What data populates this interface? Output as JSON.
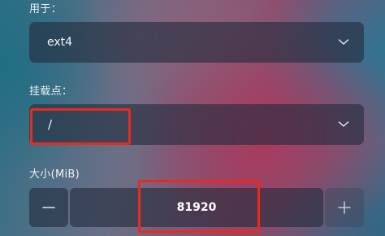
{
  "form": {
    "usage_label": "用于：",
    "filesystem_value": "ext4",
    "mount_label": "挂载点：",
    "mount_value": "/",
    "size_label": "大小(MiB)",
    "size_value": "81920"
  },
  "icons": {
    "dropdown": "chevron-down-icon",
    "decrement": "minus-icon",
    "increment": "plus-icon"
  },
  "colors": {
    "highlight_box": "#ea2a1c",
    "field_background": "rgba(36,44,62,0.62)"
  }
}
